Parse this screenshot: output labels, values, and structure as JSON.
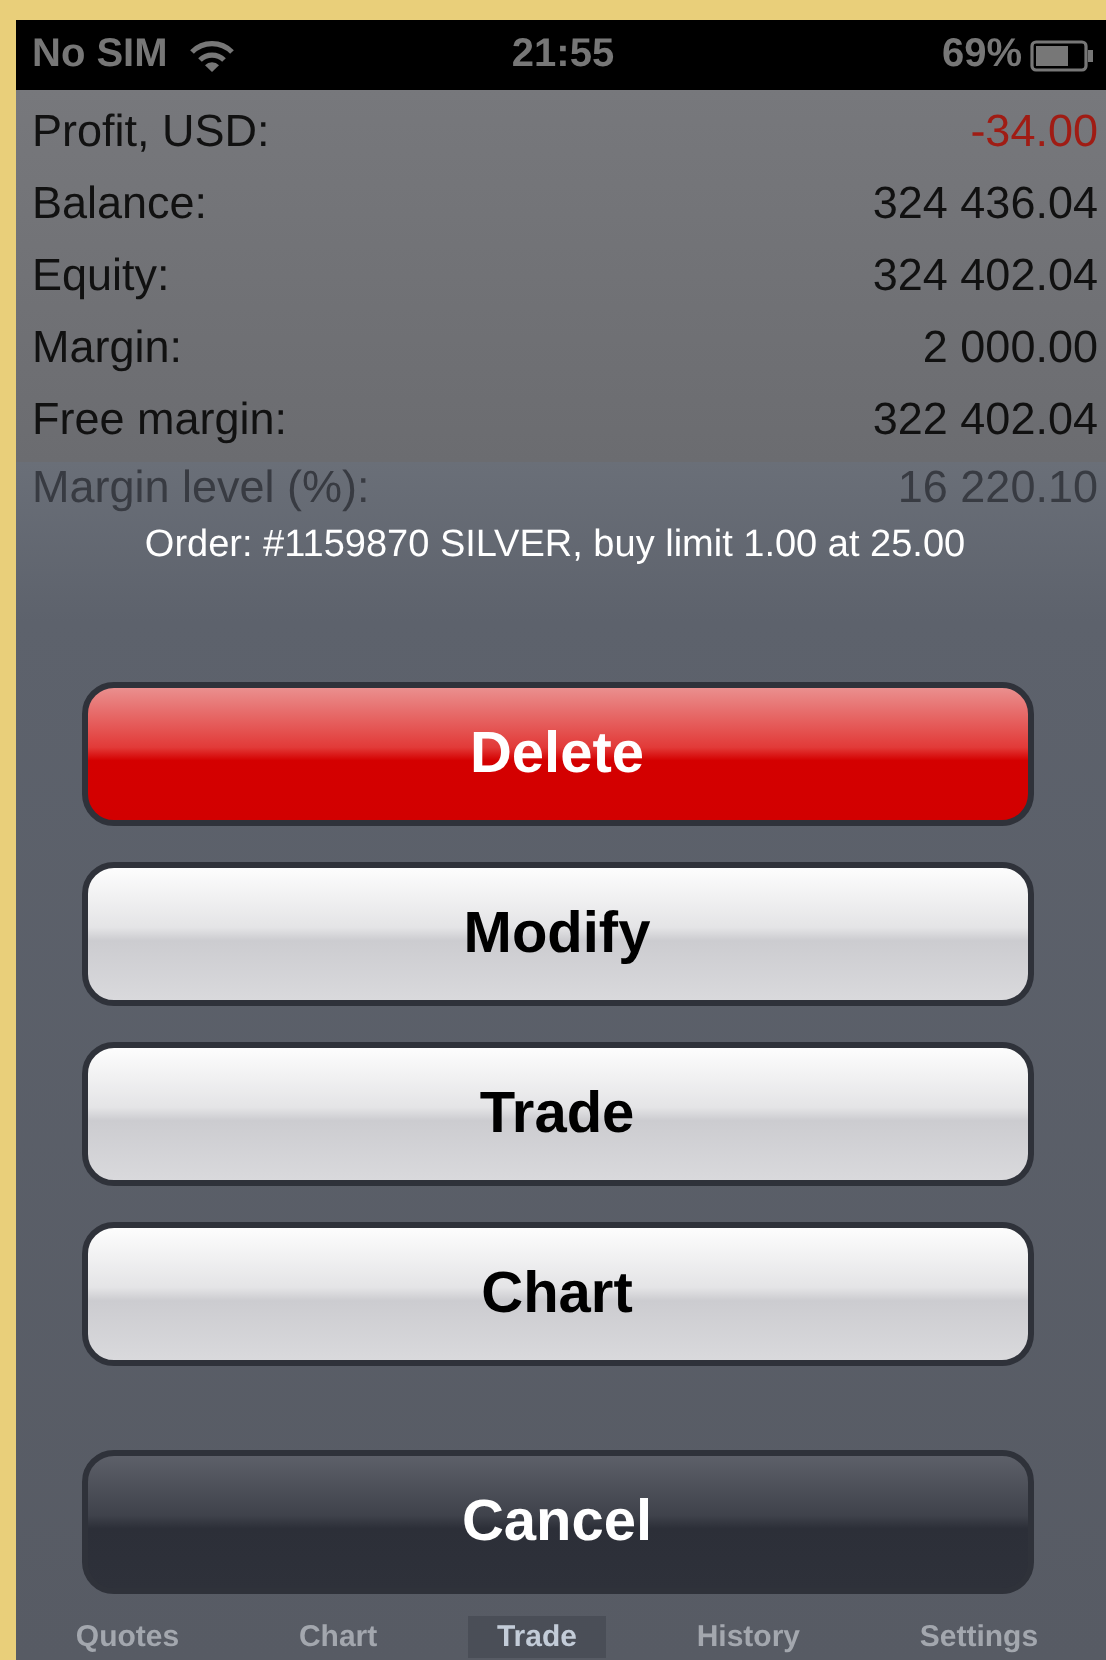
{
  "status_bar": {
    "carrier": "No SIM",
    "time": "21:55",
    "battery": "69%"
  },
  "account": [
    {
      "label": "Profit, USD:",
      "value": "-34.00",
      "negative": true
    },
    {
      "label": "Balance:",
      "value": "324 436.04",
      "negative": false
    },
    {
      "label": "Equity:",
      "value": "324 402.04",
      "negative": false
    },
    {
      "label": "Margin:",
      "value": "2 000.00",
      "negative": false
    },
    {
      "label": "Free margin:",
      "value": "322 402.04",
      "negative": false
    },
    {
      "label": "Margin level (%):",
      "value": "16 220.10",
      "negative": false
    }
  ],
  "action_sheet": {
    "title": "Order: #1159870 SILVER, buy limit 1.00 at 25.00",
    "buttons": [
      {
        "label": "Delete",
        "kind": "destructive"
      },
      {
        "label": "Modify",
        "kind": "default"
      },
      {
        "label": "Trade",
        "kind": "default"
      },
      {
        "label": "Chart",
        "kind": "default"
      },
      {
        "label": "Cancel",
        "kind": "cancel"
      }
    ]
  },
  "tab_bar": [
    {
      "label": "Quotes",
      "selected": false
    },
    {
      "label": "Chart",
      "selected": false
    },
    {
      "label": "Trade",
      "selected": true
    },
    {
      "label": "History",
      "selected": false
    },
    {
      "label": "Settings",
      "selected": false
    }
  ]
}
